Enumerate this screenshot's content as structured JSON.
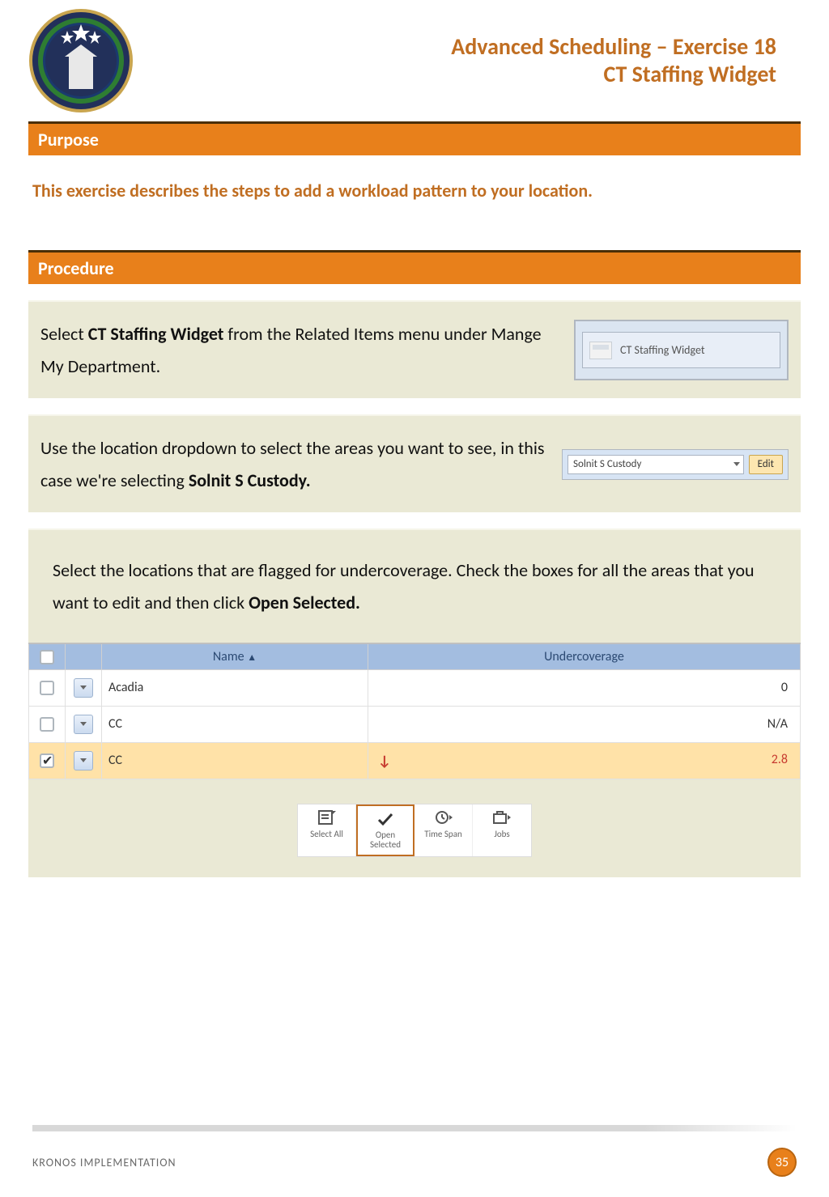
{
  "header": {
    "title_line1": "Advanced Scheduling – Exercise 18",
    "title_line2": "CT Staffing Widget"
  },
  "sections": {
    "purpose": "Purpose",
    "procedure": "Procedure"
  },
  "intro": "This exercise describes the steps to add a workload pattern to your location.",
  "step1": {
    "pre": "Select ",
    "bold": "CT Staffing Widget",
    "post": " from the Related Items menu under Mange My Department.",
    "widget_label": "CT Staffing Widget"
  },
  "step2": {
    "pre": "Use the location dropdown to select the areas you want to see, in this case we're selecting ",
    "bold": "Solnit S Custody.",
    "selected_location": "Solnit S Custody",
    "edit_label": "Edit"
  },
  "step3": {
    "pre": "Select the locations that are flagged for undercoverage. Check the boxes for all the areas that you want to edit and then click ",
    "bold": "Open Selected."
  },
  "table": {
    "headers": {
      "name": "Name",
      "under": "Undercoverage"
    },
    "rows": [
      {
        "checked": false,
        "name": "Acadia",
        "under": "0",
        "flag": false,
        "hl": false
      },
      {
        "checked": false,
        "name": "CC",
        "under": "N/A",
        "flag": false,
        "hl": false
      },
      {
        "checked": true,
        "name": "CC",
        "under": "2.8",
        "flag": true,
        "hl": true
      }
    ]
  },
  "toolbar": {
    "select_all": "Select All",
    "open_selected": "Open Selected",
    "time_span": "Time Span",
    "jobs": "Jobs"
  },
  "footer": {
    "text": "KRONOS IMPLEMENTATION",
    "page": "35"
  }
}
